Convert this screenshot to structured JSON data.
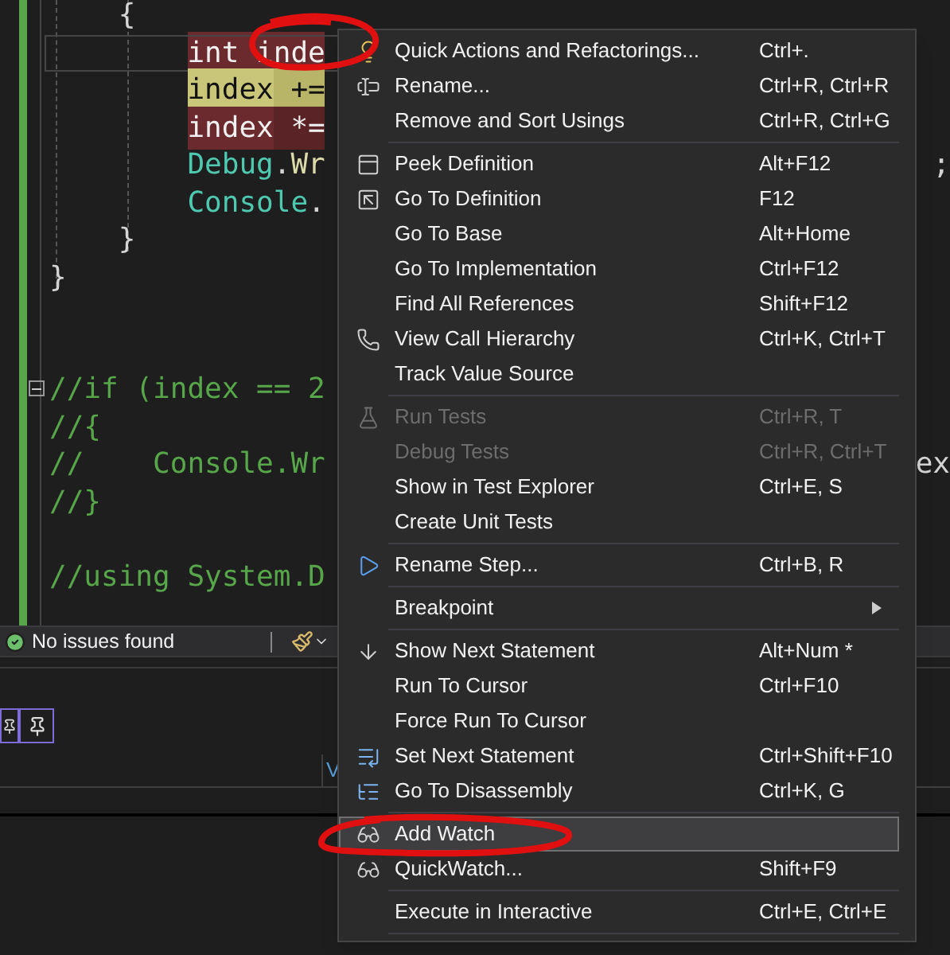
{
  "editor": {
    "lines": [
      {
        "segments": [
          {
            "text": "    {",
            "kind": "punct"
          }
        ]
      },
      {
        "segments": [
          {
            "text": "        int",
            "kind": "write_highlight"
          },
          {
            "text": " inde",
            "kind": "write_highlight"
          }
        ],
        "current": true
      },
      {
        "segments": [
          {
            "text": "        index",
            "kind": "read_highlight"
          },
          {
            "text": " +=",
            "kind": "read_highlight_soft"
          }
        ]
      },
      {
        "segments": [
          {
            "text": "        index",
            "kind": "write_highlight"
          },
          {
            "text": " *=",
            "kind": "write_highlight_soft"
          }
        ]
      },
      {
        "segments": [
          {
            "text": "        Debug",
            "kind": "type"
          },
          {
            "text": ".",
            "kind": "punct"
          },
          {
            "text": "Wr",
            "kind": "member"
          }
        ],
        "tail": ";"
      },
      {
        "segments": [
          {
            "text": "        Console",
            "kind": "type"
          },
          {
            "text": ".",
            "kind": "punct"
          }
        ]
      },
      {
        "segments": [
          {
            "text": "    }",
            "kind": "punct"
          }
        ]
      },
      {
        "segments": [
          {
            "text": "}",
            "kind": "punct"
          }
        ]
      },
      {
        "kind": "blank"
      },
      {
        "kind": "blank"
      },
      {
        "segments": [
          {
            "text": "//if (index == 2",
            "kind": "comment"
          }
        ],
        "collapsible": true
      },
      {
        "segments": [
          {
            "text": "//{",
            "kind": "comment"
          }
        ]
      },
      {
        "segments": [
          {
            "text": "//    Console.Wr",
            "kind": "comment"
          }
        ],
        "tail": "ex"
      },
      {
        "segments": [
          {
            "text": "//}",
            "kind": "comment"
          }
        ]
      },
      {
        "kind": "blank"
      },
      {
        "segments": [
          {
            "text": "//using System.D",
            "kind": "comment"
          }
        ]
      }
    ]
  },
  "status_bar": {
    "message": "No issues found"
  },
  "watch_pane": {
    "column_2_heading": "V"
  },
  "context_menu": {
    "items": [
      {
        "kind": "item",
        "label": "Quick Actions and Refactorings...",
        "shortcut": "Ctrl+.",
        "disabled": false,
        "selected": false
      },
      {
        "kind": "item",
        "label": "Rename...",
        "shortcut": "Ctrl+R, Ctrl+R",
        "disabled": false,
        "selected": false
      },
      {
        "kind": "item",
        "label": "Remove and Sort Usings",
        "shortcut": "Ctrl+R, Ctrl+G",
        "disabled": false,
        "selected": false
      },
      {
        "kind": "separator"
      },
      {
        "kind": "item",
        "label": "Peek Definition",
        "shortcut": "Alt+F12",
        "disabled": false,
        "selected": false
      },
      {
        "kind": "item",
        "label": "Go To Definition",
        "shortcut": "F12",
        "disabled": false,
        "selected": false
      },
      {
        "kind": "item",
        "label": "Go To Base",
        "shortcut": "Alt+Home",
        "disabled": false,
        "selected": false
      },
      {
        "kind": "item",
        "label": "Go To Implementation",
        "shortcut": "Ctrl+F12",
        "disabled": false,
        "selected": false
      },
      {
        "kind": "item",
        "label": "Find All References",
        "shortcut": "Shift+F12",
        "disabled": false,
        "selected": false
      },
      {
        "kind": "item",
        "label": "View Call Hierarchy",
        "shortcut": "Ctrl+K, Ctrl+T",
        "disabled": false,
        "selected": false
      },
      {
        "kind": "item",
        "label": "Track Value Source",
        "disabled": false,
        "selected": false
      },
      {
        "kind": "separator"
      },
      {
        "kind": "item",
        "label": "Run Tests",
        "shortcut": "Ctrl+R, T",
        "disabled": true,
        "selected": false
      },
      {
        "kind": "item",
        "label": "Debug Tests",
        "shortcut": "Ctrl+R, Ctrl+T",
        "disabled": true,
        "selected": false
      },
      {
        "kind": "item",
        "label": "Show in Test Explorer",
        "shortcut": "Ctrl+E, S",
        "disabled": false,
        "selected": false
      },
      {
        "kind": "item",
        "label": "Create Unit Tests",
        "disabled": false,
        "selected": false
      },
      {
        "kind": "separator"
      },
      {
        "kind": "item",
        "label": "Rename Step...",
        "shortcut": "Ctrl+B, R",
        "disabled": false,
        "selected": false
      },
      {
        "kind": "separator"
      },
      {
        "kind": "submenu",
        "label": "Breakpoint",
        "disabled": false,
        "selected": false
      },
      {
        "kind": "separator"
      },
      {
        "kind": "item",
        "label": "Show Next Statement",
        "shortcut": "Alt+Num *",
        "disabled": false,
        "selected": false
      },
      {
        "kind": "item",
        "label": "Run To Cursor",
        "shortcut": "Ctrl+F10",
        "disabled": false,
        "selected": false
      },
      {
        "kind": "item",
        "label": "Force Run To Cursor",
        "disabled": false,
        "selected": false
      },
      {
        "kind": "item",
        "label": "Set Next Statement",
        "shortcut": "Ctrl+Shift+F10",
        "disabled": false,
        "selected": false
      },
      {
        "kind": "item",
        "label": "Go To Disassembly",
        "shortcut": "Ctrl+K, G",
        "disabled": false,
        "selected": false
      },
      {
        "kind": "separator"
      },
      {
        "kind": "item",
        "label": "Add Watch",
        "disabled": false,
        "selected": true
      },
      {
        "kind": "item",
        "label": "QuickWatch...",
        "shortcut": "Shift+F9",
        "disabled": false,
        "selected": false
      },
      {
        "kind": "separator"
      },
      {
        "kind": "item",
        "label": "Execute in Interactive",
        "shortcut": "Ctrl+E, Ctrl+E",
        "disabled": false,
        "selected": false
      },
      {
        "kind": "separator"
      }
    ]
  }
}
